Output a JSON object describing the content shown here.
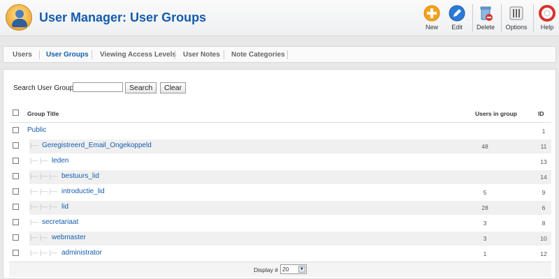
{
  "header": {
    "title": "User Manager: User Groups",
    "buttons": [
      {
        "label": "New",
        "icon": "new-icon"
      },
      {
        "label": "Edit",
        "icon": "edit-icon"
      },
      {
        "label": "Delete",
        "icon": "delete-icon"
      },
      {
        "label": "Options",
        "icon": "options-icon"
      },
      {
        "label": "Help",
        "icon": "help-icon"
      }
    ]
  },
  "submenu": {
    "tabs": [
      "Users",
      "User Groups",
      "Viewing Access Levels",
      "User Notes",
      "Note Categories"
    ],
    "active": "User Groups"
  },
  "search": {
    "label": "Search User Groups",
    "value": "",
    "search_button": "Search",
    "clear_button": "Clear"
  },
  "table": {
    "columns": [
      "Group Title",
      "Users in group",
      "ID"
    ],
    "rows": [
      {
        "title": "Public",
        "users": "",
        "id": "1",
        "depth": 0
      },
      {
        "title": "Geregistreerd_Email_Ongekoppeld",
        "users": "48",
        "id": "11",
        "depth": 1
      },
      {
        "title": "leden",
        "users": "",
        "id": "13",
        "depth": 2
      },
      {
        "title": "bestuurs_lid",
        "users": "",
        "id": "14",
        "depth": 3
      },
      {
        "title": "introductie_lid",
        "users": "5",
        "id": "9",
        "depth": 3
      },
      {
        "title": "lid",
        "users": "28",
        "id": "6",
        "depth": 3
      },
      {
        "title": "secretariaat",
        "users": "3",
        "id": "8",
        "depth": 1
      },
      {
        "title": "webmaster",
        "users": "3",
        "id": "10",
        "depth": 2
      },
      {
        "title": "administrator",
        "users": "1",
        "id": "12",
        "depth": 3
      }
    ]
  },
  "footer": {
    "display_label": "Display #",
    "display_value": "20"
  },
  "colors": {
    "accent": "#135cae",
    "row_alt": "#f0f0f0"
  }
}
